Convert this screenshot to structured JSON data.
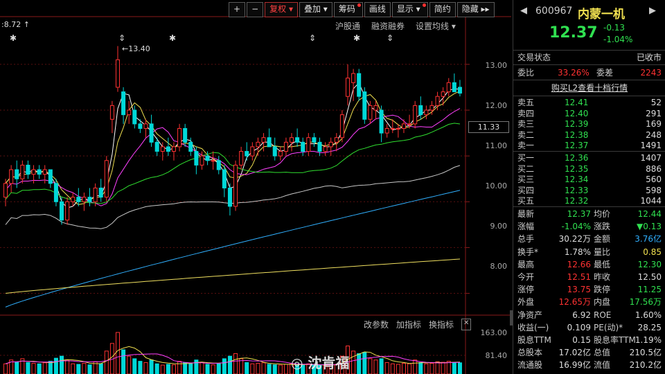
{
  "toolbar": {
    "buttons": [
      {
        "label": "+",
        "red": false,
        "dot": false
      },
      {
        "label": "−",
        "red": false,
        "dot": false
      },
      {
        "label": "复权 ▾",
        "red": true,
        "dot": false
      },
      {
        "label": "叠加 ▾",
        "red": false,
        "dot": false
      },
      {
        "label": "筹码",
        "red": false,
        "dot": true
      },
      {
        "label": "画线",
        "red": false,
        "dot": false
      },
      {
        "label": "显示 ▾",
        "red": false,
        "dot": true
      },
      {
        "label": "简约",
        "red": false,
        "dot": false
      },
      {
        "label": "隐藏 ▸▸",
        "red": false,
        "dot": false
      }
    ]
  },
  "chart": {
    "ma_info": ":8.72 ↑",
    "links": [
      "沪股通",
      "融资融券",
      "设置均线 ▾"
    ],
    "sub_links": [
      "改参数",
      "加指标",
      "换指标",
      "✕"
    ],
    "high_label": "←13.40",
    "current_price_box": "11.33",
    "price_axis": [
      "13.00",
      "12.00",
      "11.00",
      "10.00",
      "9.00",
      "8.00"
    ],
    "volume_axis": [
      "163.00",
      "81.40"
    ],
    "watermark": "沈肯福",
    "colors": {
      "up": "#ff3232",
      "down": "#00d8d8"
    }
  },
  "chart_data": {
    "type": "candlestick",
    "ylim": [
      7.6,
      13.8
    ],
    "candles": [
      {
        "o": 10.1,
        "h": 10.5,
        "l": 9.9,
        "c": 10.4
      },
      {
        "o": 10.4,
        "h": 10.8,
        "l": 10.2,
        "c": 10.7
      },
      {
        "o": 10.7,
        "h": 10.9,
        "l": 10.3,
        "c": 10.5
      },
      {
        "o": 10.5,
        "h": 10.9,
        "l": 10.4,
        "c": 10.8
      },
      {
        "o": 10.8,
        "h": 10.9,
        "l": 10.5,
        "c": 10.6
      },
      {
        "o": 10.6,
        "h": 10.8,
        "l": 10.4,
        "c": 10.7
      },
      {
        "o": 10.7,
        "h": 10.8,
        "l": 10.5,
        "c": 10.6
      },
      {
        "o": 10.6,
        "h": 10.8,
        "l": 10.4,
        "c": 10.7
      },
      {
        "o": 10.7,
        "h": 10.7,
        "l": 10.3,
        "c": 10.4
      },
      {
        "o": 10.4,
        "h": 10.5,
        "l": 9.9,
        "c": 10.0
      },
      {
        "o": 10.0,
        "h": 10.1,
        "l": 9.5,
        "c": 9.6
      },
      {
        "o": 9.6,
        "h": 10.1,
        "l": 9.5,
        "c": 10.0
      },
      {
        "o": 10.0,
        "h": 10.2,
        "l": 9.9,
        "c": 10.1
      },
      {
        "o": 10.1,
        "h": 10.3,
        "l": 9.9,
        "c": 10.0
      },
      {
        "o": 10.0,
        "h": 10.2,
        "l": 9.8,
        "c": 10.1
      },
      {
        "o": 10.1,
        "h": 10.3,
        "l": 9.9,
        "c": 10.0
      },
      {
        "o": 10.0,
        "h": 10.4,
        "l": 9.9,
        "c": 10.3
      },
      {
        "o": 10.3,
        "h": 10.5,
        "l": 10.0,
        "c": 10.1
      },
      {
        "o": 10.1,
        "h": 11.0,
        "l": 10.0,
        "c": 10.9
      },
      {
        "o": 11.8,
        "h": 12.2,
        "l": 11.5,
        "c": 12.1
      },
      {
        "o": 12.5,
        "h": 13.4,
        "l": 12.4,
        "c": 13.1
      },
      {
        "o": 12.4,
        "h": 12.5,
        "l": 11.7,
        "c": 11.9
      },
      {
        "o": 11.9,
        "h": 12.2,
        "l": 11.7,
        "c": 12.0
      },
      {
        "o": 12.0,
        "h": 12.1,
        "l": 11.6,
        "c": 11.7
      },
      {
        "o": 11.7,
        "h": 11.8,
        "l": 11.5,
        "c": 11.6
      },
      {
        "o": 11.6,
        "h": 11.8,
        "l": 11.4,
        "c": 11.7
      },
      {
        "o": 11.7,
        "h": 11.9,
        "l": 11.2,
        "c": 11.3
      },
      {
        "o": 11.3,
        "h": 11.4,
        "l": 11.0,
        "c": 11.1
      },
      {
        "o": 11.1,
        "h": 11.3,
        "l": 10.9,
        "c": 11.2
      },
      {
        "o": 11.2,
        "h": 11.4,
        "l": 11.0,
        "c": 11.1
      },
      {
        "o": 11.1,
        "h": 11.3,
        "l": 10.9,
        "c": 11.2
      },
      {
        "o": 11.2,
        "h": 11.7,
        "l": 11.1,
        "c": 11.6
      },
      {
        "o": 11.6,
        "h": 11.7,
        "l": 11.2,
        "c": 11.3
      },
      {
        "o": 11.3,
        "h": 11.4,
        "l": 11.0,
        "c": 11.1
      },
      {
        "o": 11.1,
        "h": 11.2,
        "l": 10.6,
        "c": 10.8
      },
      {
        "o": 10.8,
        "h": 11.1,
        "l": 10.7,
        "c": 11.0
      },
      {
        "o": 11.0,
        "h": 11.1,
        "l": 10.8,
        "c": 10.9
      },
      {
        "o": 10.9,
        "h": 11.1,
        "l": 10.7,
        "c": 10.9
      },
      {
        "o": 10.9,
        "h": 11.0,
        "l": 10.6,
        "c": 10.7
      },
      {
        "o": 10.7,
        "h": 10.8,
        "l": 10.1,
        "c": 10.3
      },
      {
        "o": 10.3,
        "h": 10.4,
        "l": 9.7,
        "c": 9.9
      },
      {
        "o": 9.9,
        "h": 10.9,
        "l": 9.8,
        "c": 10.8
      },
      {
        "o": 10.8,
        "h": 11.2,
        "l": 10.7,
        "c": 11.1
      },
      {
        "o": 11.1,
        "h": 11.3,
        "l": 10.9,
        "c": 11.0
      },
      {
        "o": 11.0,
        "h": 11.3,
        "l": 10.9,
        "c": 11.2
      },
      {
        "o": 11.2,
        "h": 11.4,
        "l": 11.0,
        "c": 11.3
      },
      {
        "o": 11.3,
        "h": 11.5,
        "l": 11.1,
        "c": 11.4
      },
      {
        "o": 11.4,
        "h": 11.6,
        "l": 11.2,
        "c": 11.2
      },
      {
        "o": 11.2,
        "h": 11.4,
        "l": 10.9,
        "c": 11.0
      },
      {
        "o": 11.0,
        "h": 11.2,
        "l": 10.9,
        "c": 11.1
      },
      {
        "o": 11.1,
        "h": 11.4,
        "l": 11.0,
        "c": 11.3
      },
      {
        "o": 11.3,
        "h": 11.5,
        "l": 11.1,
        "c": 11.4
      },
      {
        "o": 11.4,
        "h": 11.6,
        "l": 11.2,
        "c": 11.3
      },
      {
        "o": 11.3,
        "h": 11.4,
        "l": 11.0,
        "c": 11.1
      },
      {
        "o": 11.1,
        "h": 11.5,
        "l": 11.0,
        "c": 11.4
      },
      {
        "o": 11.4,
        "h": 11.5,
        "l": 11.2,
        "c": 11.3
      },
      {
        "o": 11.3,
        "h": 11.4,
        "l": 11.0,
        "c": 11.1
      },
      {
        "o": 11.1,
        "h": 11.3,
        "l": 11.0,
        "c": 11.2
      },
      {
        "o": 11.2,
        "h": 11.4,
        "l": 11.0,
        "c": 11.3
      },
      {
        "o": 11.3,
        "h": 11.5,
        "l": 11.1,
        "c": 11.4
      },
      {
        "o": 11.4,
        "h": 12.0,
        "l": 11.3,
        "c": 11.9
      },
      {
        "o": 12.3,
        "h": 13.0,
        "l": 12.1,
        "c": 12.7
      },
      {
        "o": 12.6,
        "h": 12.9,
        "l": 12.2,
        "c": 12.8
      },
      {
        "o": 12.8,
        "h": 12.9,
        "l": 12.2,
        "c": 12.3
      },
      {
        "o": 12.4,
        "h": 12.5,
        "l": 11.7,
        "c": 11.8
      },
      {
        "o": 11.8,
        "h": 12.2,
        "l": 11.7,
        "c": 12.1
      },
      {
        "o": 12.0,
        "h": 12.2,
        "l": 11.8,
        "c": 12.1
      },
      {
        "o": 12.0,
        "h": 12.1,
        "l": 11.3,
        "c": 11.5
      },
      {
        "o": 11.5,
        "h": 11.7,
        "l": 11.4,
        "c": 11.6
      },
      {
        "o": 11.6,
        "h": 11.8,
        "l": 11.5,
        "c": 11.6
      },
      {
        "o": 11.6,
        "h": 11.7,
        "l": 11.4,
        "c": 11.6
      },
      {
        "o": 11.6,
        "h": 11.8,
        "l": 11.5,
        "c": 11.7
      },
      {
        "o": 11.7,
        "h": 11.9,
        "l": 11.6,
        "c": 11.7
      },
      {
        "o": 11.7,
        "h": 12.2,
        "l": 11.6,
        "c": 12.1
      },
      {
        "o": 12.1,
        "h": 12.3,
        "l": 11.8,
        "c": 11.9
      },
      {
        "o": 11.9,
        "h": 12.1,
        "l": 11.8,
        "c": 12.0
      },
      {
        "o": 12.0,
        "h": 12.2,
        "l": 11.9,
        "c": 12.1
      },
      {
        "o": 12.1,
        "h": 12.4,
        "l": 12.0,
        "c": 12.3
      },
      {
        "o": 12.3,
        "h": 12.5,
        "l": 12.1,
        "c": 12.4
      },
      {
        "o": 12.4,
        "h": 12.7,
        "l": 12.3,
        "c": 12.6
      },
      {
        "o": 12.6,
        "h": 12.8,
        "l": 12.4,
        "c": 12.4
      },
      {
        "o": 12.5,
        "h": 12.66,
        "l": 12.3,
        "c": 12.37
      }
    ],
    "ma_colors": [
      "#ffffff",
      "#f0e050",
      "#ff40ff",
      "#30e030",
      "#c8c8c8",
      "#30b0ff",
      "#f0e060"
    ],
    "long_ma": [
      {
        "color": "#30b0ff",
        "from": 7.7,
        "to": 10.25
      },
      {
        "color": "#f0e060",
        "from": 8.0,
        "to": 8.75
      }
    ],
    "volumes": [
      40,
      55,
      48,
      60,
      45,
      42,
      40,
      44,
      50,
      62,
      70,
      55,
      40,
      38,
      42,
      36,
      48,
      40,
      90,
      120,
      163,
      95,
      70,
      60,
      50,
      45,
      55,
      40,
      35,
      38,
      36,
      50,
      45,
      40,
      55,
      45,
      38,
      36,
      40,
      60,
      70,
      80,
      60,
      45,
      40,
      42,
      44,
      38,
      36,
      35,
      38,
      40,
      36,
      34,
      40,
      36,
      35,
      34,
      36,
      38,
      70,
      110,
      90,
      80,
      85,
      60,
      55,
      60,
      45,
      40,
      38,
      42,
      40,
      55,
      45,
      40,
      42,
      48,
      46,
      50,
      45,
      44
    ]
  },
  "quote": {
    "code": "600967",
    "name": "内蒙一机",
    "price": "12.37",
    "change": "-0.13",
    "change_pct": "-1.04%",
    "status_label": "交易状态",
    "status_value": "已收市",
    "weibi_label": "委比",
    "weibi_value": "33.26%",
    "weicha_label": "委差",
    "weicha_value": "2243",
    "l2_link": "购买L2查看十档行情",
    "asks": [
      {
        "label": "卖五",
        "price": "12.41",
        "vol": "52"
      },
      {
        "label": "卖四",
        "price": "12.40",
        "vol": "291"
      },
      {
        "label": "卖三",
        "price": "12.39",
        "vol": "169"
      },
      {
        "label": "卖二",
        "price": "12.38",
        "vol": "248"
      },
      {
        "label": "卖一",
        "price": "12.37",
        "vol": "1491"
      }
    ],
    "bids": [
      {
        "label": "买一",
        "price": "12.36",
        "vol": "1407"
      },
      {
        "label": "买二",
        "price": "12.35",
        "vol": "886"
      },
      {
        "label": "买三",
        "price": "12.34",
        "vol": "560"
      },
      {
        "label": "买四",
        "price": "12.33",
        "vol": "598"
      },
      {
        "label": "买五",
        "price": "12.32",
        "vol": "1044"
      }
    ],
    "stats": [
      [
        {
          "l": "最新",
          "v": "12.37",
          "c": "#30e050"
        },
        {
          "l": "均价",
          "v": "12.44",
          "c": "#30e050"
        }
      ],
      [
        {
          "l": "涨幅",
          "v": "-1.04%",
          "c": "#30e050"
        },
        {
          "l": "涨跌",
          "v": "▼0.13",
          "c": "#30e050"
        }
      ],
      [
        {
          "l": "总手",
          "v": "30.22万",
          "c": "#ddd"
        },
        {
          "l": "金额",
          "v": "3.76亿",
          "c": "#30b0ff"
        }
      ],
      [
        {
          "l": "换手*",
          "v": "1.78%",
          "c": "#ddd"
        },
        {
          "l": "量比",
          "v": "0.85",
          "c": "#f0e050"
        }
      ],
      [
        {
          "l": "最高",
          "v": "12.66",
          "c": "#ff3232"
        },
        {
          "l": "最低",
          "v": "12.30",
          "c": "#30e050"
        }
      ],
      [
        {
          "l": "今开",
          "v": "12.51",
          "c": "#ff3232"
        },
        {
          "l": "昨收",
          "v": "12.50",
          "c": "#ddd"
        }
      ],
      [
        {
          "l": "涨停",
          "v": "13.75",
          "c": "#ff3232"
        },
        {
          "l": "跌停",
          "v": "11.25",
          "c": "#30e050"
        }
      ],
      [
        {
          "l": "外盘",
          "v": "12.65万",
          "c": "#ff3232"
        },
        {
          "l": "内盘",
          "v": "17.56万",
          "c": "#30e050"
        }
      ],
      [
        {
          "l": "净资产",
          "v": "6.92",
          "c": "#ddd"
        },
        {
          "l": "ROE",
          "v": "1.60%",
          "c": "#ddd"
        }
      ],
      [
        {
          "l": "收益(一)",
          "v": "0.109",
          "c": "#ddd"
        },
        {
          "l": "PE(动)*",
          "v": "28.25",
          "c": "#ddd"
        }
      ],
      [
        {
          "l": "股息TTM",
          "v": "0.15",
          "c": "#ddd"
        },
        {
          "l": "股息率TTM",
          "v": "1.19%",
          "c": "#ddd"
        }
      ],
      [
        {
          "l": "总股本",
          "v": "17.02亿",
          "c": "#ddd"
        },
        {
          "l": "总值",
          "v": "210.5亿",
          "c": "#ddd"
        }
      ],
      [
        {
          "l": "流通股",
          "v": "16.99亿",
          "c": "#ddd"
        },
        {
          "l": "流值",
          "v": "210.2亿",
          "c": "#ddd"
        }
      ]
    ]
  }
}
